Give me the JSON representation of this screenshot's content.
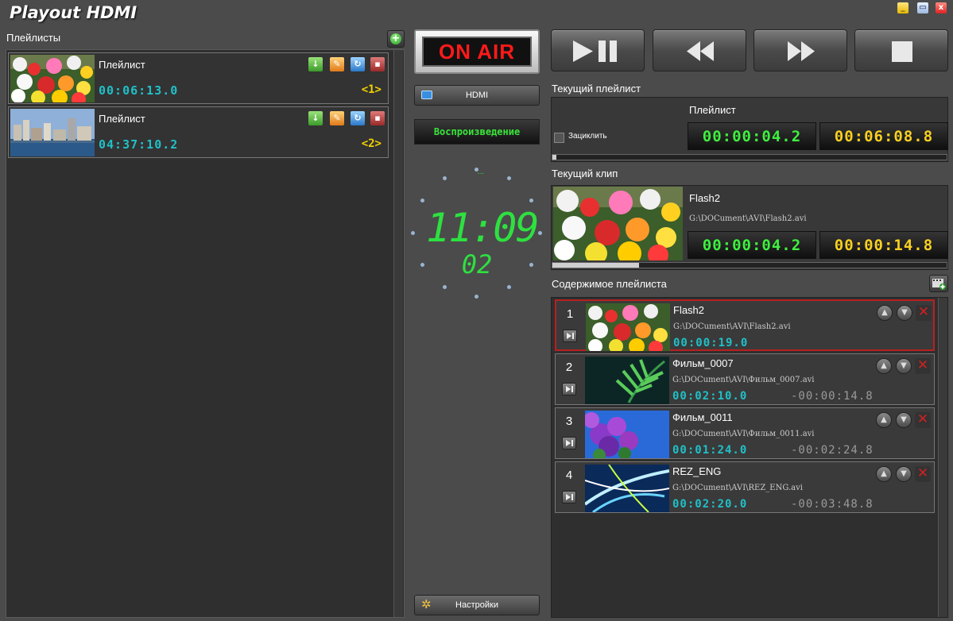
{
  "app": {
    "title": "Playout HDMI"
  },
  "window": {
    "minimize": "_",
    "maximize": "▭",
    "close": "x"
  },
  "playlists": {
    "label": "Плейлисты",
    "items": [
      {
        "name": "Плейлист",
        "duration": "00:06:13.0",
        "index": "<1>"
      },
      {
        "name": "Плейлист",
        "duration": "04:37:10.2",
        "index": "<2>"
      }
    ]
  },
  "onair": {
    "label": "ON AIR"
  },
  "output": {
    "label": "HDMI"
  },
  "status": {
    "label": "Воспроизведение"
  },
  "clock": {
    "time": "11:09",
    "seconds": "02",
    "ampm": "..."
  },
  "settings": {
    "label": "Настройки"
  },
  "current_playlist": {
    "label": "Текущий плейлист",
    "name": "Плейлист",
    "loop_label": "Зациклить",
    "elapsed": "00:00:04.2",
    "remaining": "00:06:08.8",
    "progress": 0.01
  },
  "current_clip": {
    "label": "Текущий клип",
    "name": "Flash2",
    "path": "G:\\DOCument\\AVI\\Flash2.avi",
    "elapsed": "00:00:04.2",
    "remaining": "00:00:14.8",
    "progress": 0.22
  },
  "playlist_content": {
    "label": "Содержимое плейлиста",
    "items": [
      {
        "num": "1",
        "name": "Flash2",
        "path": "G:\\DOCument\\AVI\\Flash2.avi",
        "duration": "00:00:19.0",
        "remaining": ""
      },
      {
        "num": "2",
        "name": "Фильм_0007",
        "path": "G:\\DOCument\\AVI\\Фильм_0007.avi",
        "duration": "00:02:10.0",
        "remaining": "-00:00:14.8"
      },
      {
        "num": "3",
        "name": "Фильм_0011",
        "path": "G:\\DOCument\\AVI\\Фильм_0011.avi",
        "duration": "00:01:24.0",
        "remaining": "-00:02:24.8"
      },
      {
        "num": "4",
        "name": "REZ_ENG",
        "path": "G:\\DOCument\\AVI\\REZ_ENG.avi",
        "duration": "00:02:20.0",
        "remaining": "-00:03:48.8"
      }
    ]
  },
  "colors": {
    "accent_green": "#3ef03e",
    "accent_yellow": "#f8d020",
    "accent_cyan": "#20c0c8",
    "onair_red": "#ff1a1a"
  }
}
